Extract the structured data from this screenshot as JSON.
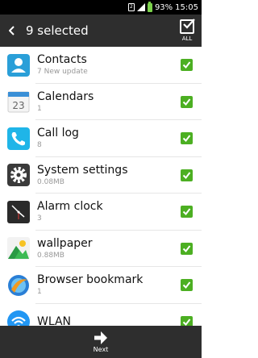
{
  "status_bar": {
    "battery_percent": "93%",
    "time": "15:05",
    "battery_color": "#7bd24b"
  },
  "header": {
    "title": "9 selected",
    "select_all_label": "ALL"
  },
  "items": [
    {
      "name": "Contacts",
      "sub": "7   New update",
      "icon": "contacts-icon",
      "checked": true
    },
    {
      "name": "Calendars",
      "sub": "1",
      "icon": "calendar-icon",
      "checked": true
    },
    {
      "name": "Call log",
      "sub": "8",
      "icon": "call-log-icon",
      "checked": true
    },
    {
      "name": "System settings",
      "sub": "0.08MB",
      "icon": "gear-icon",
      "checked": true
    },
    {
      "name": "Alarm clock",
      "sub": "3",
      "icon": "alarm-clock-icon",
      "checked": true
    },
    {
      "name": "wallpaper",
      "sub": "0.88MB",
      "icon": "wallpaper-icon",
      "checked": true
    },
    {
      "name": "Browser bookmark",
      "sub": "1",
      "icon": "browser-icon",
      "checked": true
    },
    {
      "name": "WLAN",
      "sub": "",
      "icon": "wifi-icon",
      "checked": true
    }
  ],
  "footer": {
    "next_label": "Next"
  },
  "colors": {
    "check": "#4caf22",
    "bar": "#2e2e2e"
  }
}
